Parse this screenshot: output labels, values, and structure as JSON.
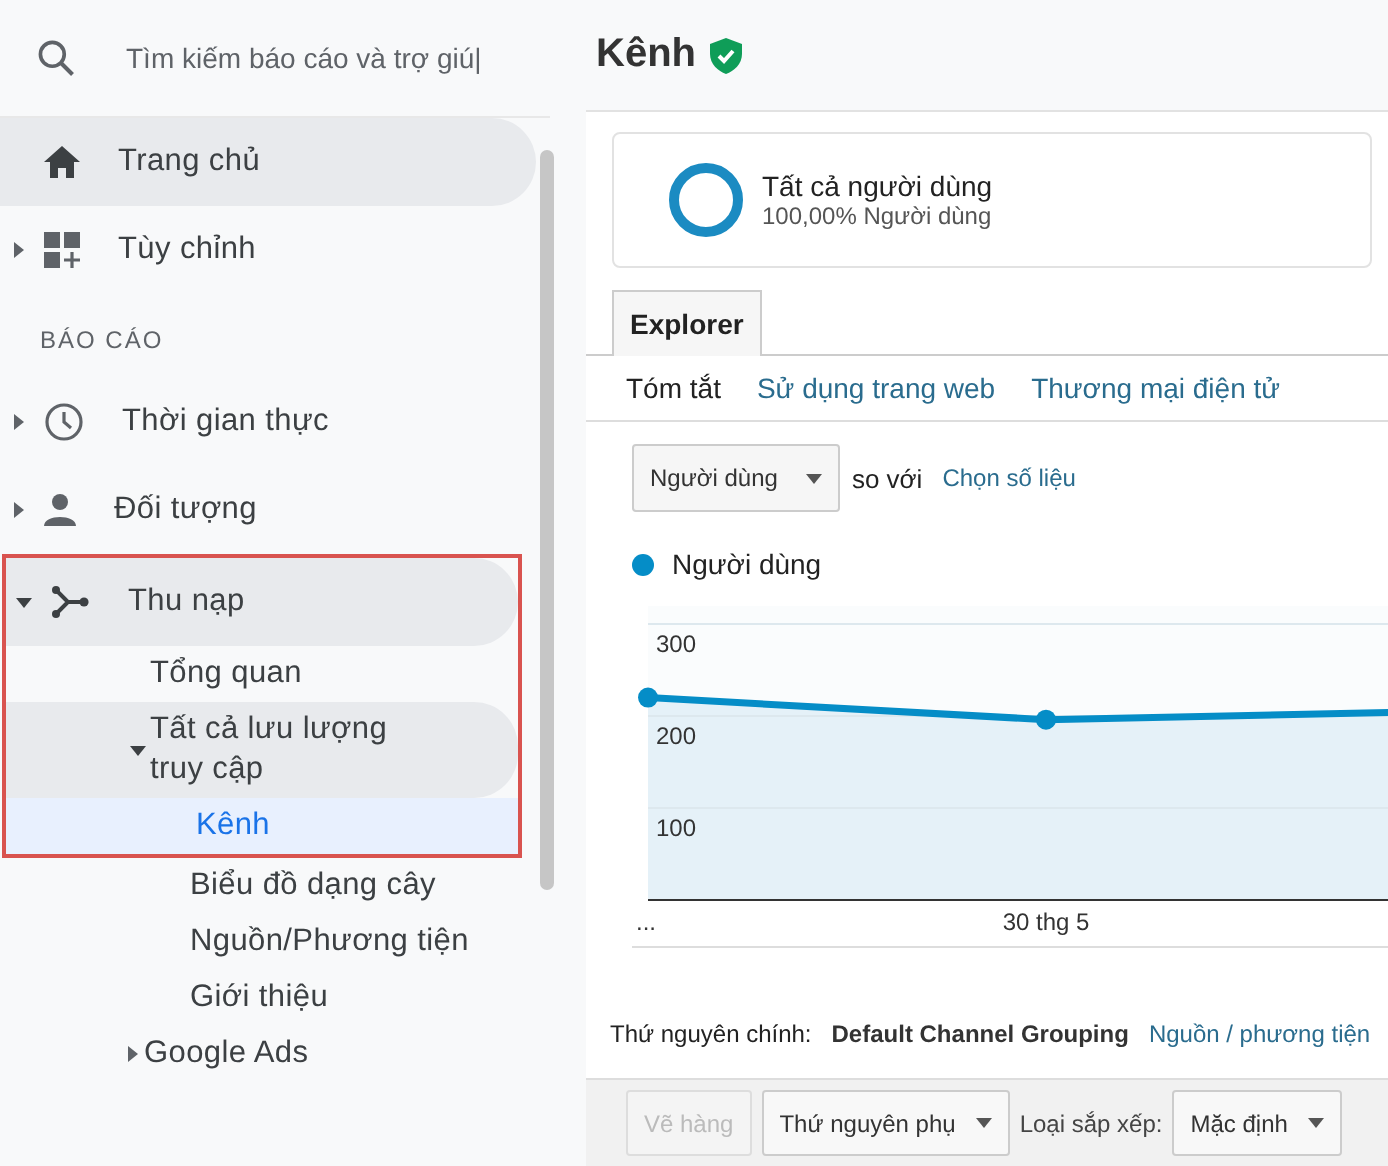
{
  "search": {
    "placeholder": "Tìm kiếm báo cáo và trợ giú|"
  },
  "sidebar": {
    "items": [
      {
        "kind": "item",
        "label": "Trang chủ",
        "highlighted": true,
        "selected": false,
        "boxed": false
      },
      {
        "kind": "item",
        "label": "Tùy chỉnh",
        "expanded": false,
        "highlighted": false,
        "selected": false,
        "boxed": false
      },
      {
        "kind": "header",
        "label": "BÁO CÁO"
      },
      {
        "kind": "item",
        "label": "Thời gian thực",
        "expanded": false,
        "highlighted": false,
        "selected": false,
        "boxed": false
      },
      {
        "kind": "item",
        "label": "Đối tượng",
        "expanded": false,
        "highlighted": false,
        "selected": false,
        "boxed": false
      },
      {
        "kind": "item",
        "label": "Thu nạp",
        "expanded": true,
        "highlighted": true,
        "selected": false,
        "boxed": true,
        "children": [
          {
            "kind": "item",
            "label": "Tổng quan",
            "highlighted": false,
            "selected": false,
            "boxed": true
          },
          {
            "kind": "item",
            "label": "Tất cả lưu lượng truy cập",
            "expanded": true,
            "highlighted": true,
            "selected": false,
            "boxed": true,
            "children": [
              {
                "kind": "item",
                "label": "Kênh",
                "highlighted": false,
                "selected": true,
                "boxed": true
              },
              {
                "kind": "item",
                "label": "Biểu đồ dạng cây",
                "highlighted": false,
                "selected": false,
                "boxed": false
              },
              {
                "kind": "item",
                "label": "Nguồn/Phương tiện",
                "highlighted": false,
                "selected": false,
                "boxed": false
              },
              {
                "kind": "item",
                "label": "Giới thiệu",
                "highlighted": false,
                "selected": false,
                "boxed": false
              }
            ]
          },
          {
            "kind": "item",
            "label": "Google Ads",
            "expanded": false,
            "highlighted": false,
            "selected": false,
            "boxed": false
          }
        ]
      }
    ]
  },
  "page": {
    "title": "Kênh",
    "verified": true
  },
  "segment": {
    "name": "Tất cả người dùng",
    "detail": "100,00% Người dùng"
  },
  "tabs": [
    {
      "label": "Explorer",
      "selected": true
    }
  ],
  "subtabs": [
    {
      "label": "Tóm tắt",
      "selected": true
    },
    {
      "label": "Sử dụng trang web",
      "selected": false
    },
    {
      "label": "Thương mại điện tử",
      "selected": false
    }
  ],
  "metric": {
    "value": "Người dùng",
    "compare_text": "so với",
    "compare_link": "Chọn số liệu"
  },
  "chart": {
    "chart_data": {
      "type": "area",
      "categories": [
        "...",
        "30 thg 5",
        null
      ],
      "ylim": [
        0,
        300
      ],
      "yticks": [
        100,
        200,
        300
      ],
      "series": [
        {
          "name": "Người dùng",
          "color": "#058dc7",
          "values": [
            220,
            196,
            205
          ]
        }
      ]
    }
  },
  "dimension": {
    "label": "Thứ nguyên chính:",
    "current": "Default Channel Grouping",
    "other": "Nguồn / phương tiện"
  },
  "toolbar": {
    "plot_button": {
      "label": "Vẽ hàng",
      "disabled": true
    },
    "secondary": "Thứ nguyên phụ",
    "sort_label": "Loại sắp xếp:",
    "sort_value": "Mặc định"
  }
}
